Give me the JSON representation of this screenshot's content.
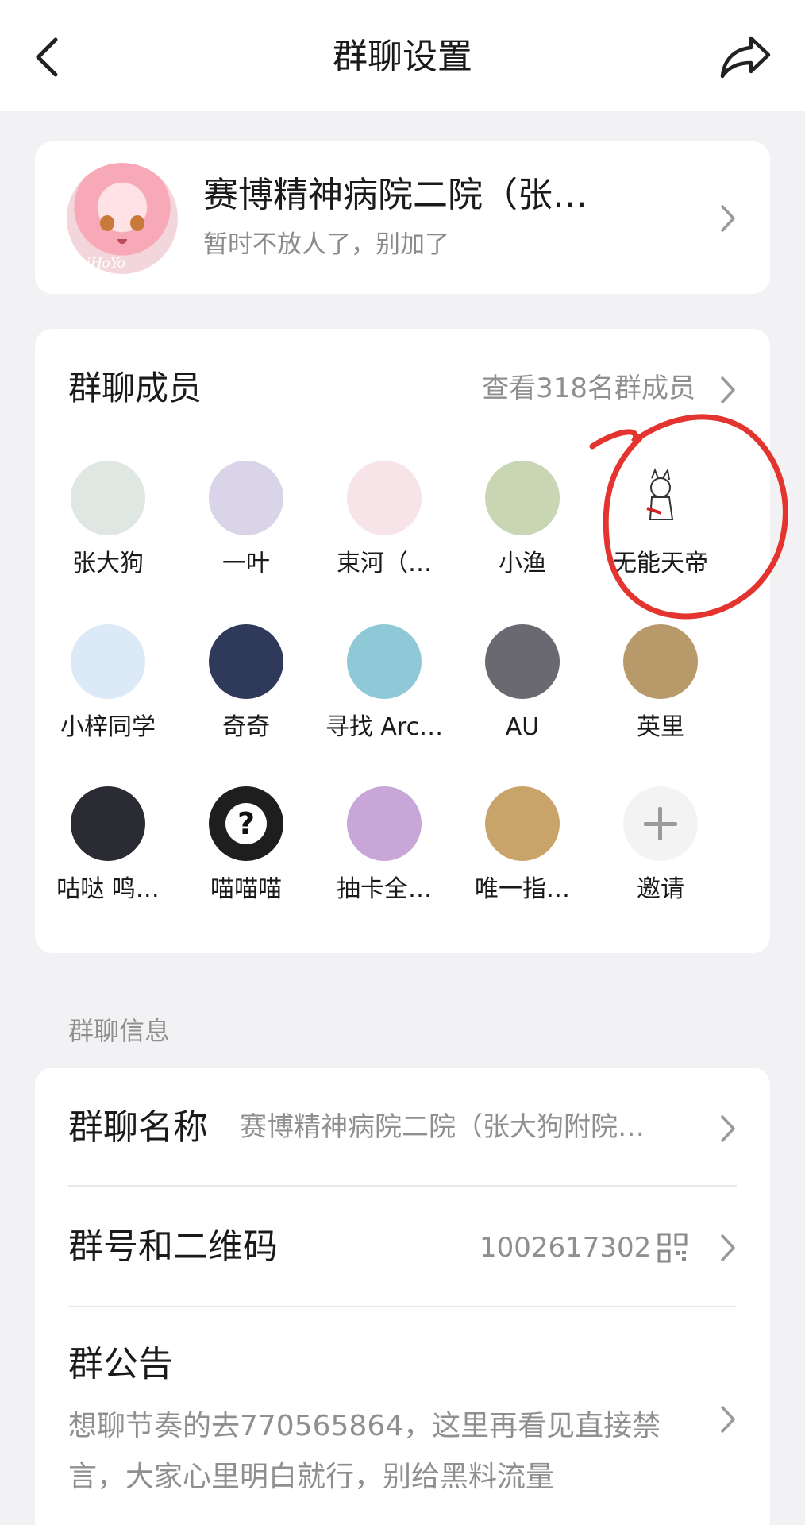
{
  "header": {
    "title": "群聊设置",
    "back_icon": "back-arrow-icon",
    "share_icon": "share-icon"
  },
  "group": {
    "name": "赛博精神病院二院（张…",
    "subtitle": "暂时不放人了，别加了",
    "avatar_watermark": "miHoYo"
  },
  "members": {
    "label": "群聊成员",
    "view_all": "查看318名群成员",
    "list": [
      {
        "name": "张大狗",
        "color": "#dfe7e3"
      },
      {
        "name": "一叶",
        "color": "#d9d4e8"
      },
      {
        "name": "束河（…",
        "color": "#f6e4e8"
      },
      {
        "name": "小渔",
        "color": "#c9d6b4"
      },
      {
        "name": "无能天帝",
        "color": "#ffffff"
      },
      {
        "name": "小梓同学",
        "color": "#dbeaf6"
      },
      {
        "name": "奇奇",
        "color": "#2f3a5a"
      },
      {
        "name": "寻找 Arc…",
        "color": "#8fc9d8"
      },
      {
        "name": "AU",
        "color": "#6a6870"
      },
      {
        "name": "英里",
        "color": "#b89a6a"
      },
      {
        "name": "咕哒 鸣…",
        "color": "#2b2b33"
      },
      {
        "name": "喵喵喵",
        "color": "#1e1e1e"
      },
      {
        "name": "抽卡全…",
        "color": "#c9a6d8"
      },
      {
        "name": "唯一指…",
        "color": "#c9a46a"
      }
    ],
    "invite_label": "邀请"
  },
  "info": {
    "heading": "群聊信息",
    "name_label": "群聊名称",
    "name_value": "赛博精神病院二院（张大狗附院…",
    "number_label": "群号和二维码",
    "number_value": "1002617302",
    "notice_label": "群公告",
    "notice_text": "想聊节奏的去770565864，这里再看见直接禁言，大家心里明白就行，别给黑料流量"
  },
  "colors": {
    "background": "#f2f2f5",
    "card": "#ffffff",
    "annotation": "#e4342f"
  }
}
